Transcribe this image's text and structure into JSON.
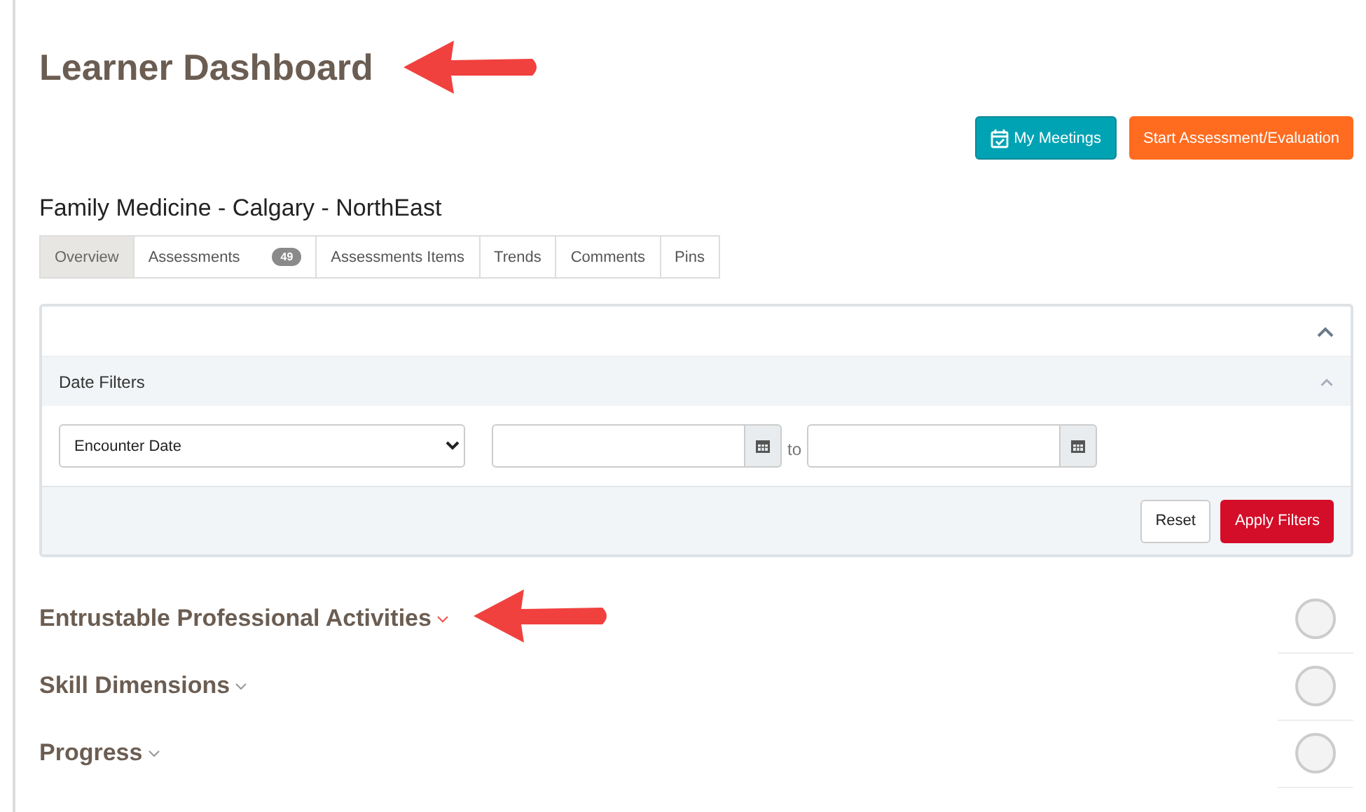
{
  "page": {
    "title": "Learner Dashboard",
    "title_pointer": true
  },
  "header_buttons": [
    {
      "label": "My Meetings",
      "kind": "meetings"
    },
    {
      "label": "Start Assessment/Evaluation",
      "kind": "start"
    }
  ],
  "program": "Family Medicine - Calgary - NorthEast",
  "tabs": [
    {
      "label": "Overview",
      "selected": true
    },
    {
      "label": "Assessments",
      "badge": "49",
      "selected": false
    },
    {
      "label": "Assessments Items",
      "selected": false
    },
    {
      "label": "Trends",
      "selected": false
    },
    {
      "label": "Comments",
      "selected": false
    },
    {
      "label": "Pins",
      "selected": false
    }
  ],
  "filters": {
    "expanded": true,
    "section_title": "Date Filters",
    "date_type": "Encounter Date",
    "range_separator": "to",
    "buttons": [
      {
        "label": "Reset",
        "kind": "reset"
      },
      {
        "label": "Apply Filters",
        "kind": "apply"
      }
    ]
  },
  "sections": [
    {
      "title": "Entrustable Professional Activities",
      "highlighted": true,
      "pointer": true
    },
    {
      "title": "Skill Dimensions",
      "highlighted": false,
      "pointer": false
    },
    {
      "title": "Progress",
      "highlighted": false,
      "pointer": false
    }
  ]
}
